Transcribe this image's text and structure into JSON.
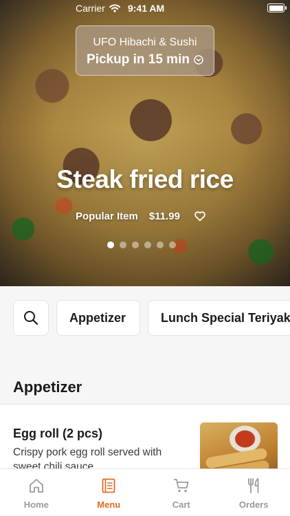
{
  "status_bar": {
    "carrier": "Carrier",
    "time": "9:41 AM"
  },
  "store": {
    "name": "UFO Hibachi & Sushi",
    "pickup": "Pickup in 15 min"
  },
  "hero": {
    "dish_name": "Steak fried rice",
    "badge": "Popular Item",
    "price": "$11.99",
    "slide_count": 6,
    "active_slide": 1
  },
  "categories": {
    "items": [
      "Appetizer",
      "Lunch Special Teriyaki"
    ]
  },
  "section": {
    "title": "Appetizer"
  },
  "menu_item": {
    "name": "Egg roll (2 pcs)",
    "description": "Crispy pork egg roll served with sweet chili sauce"
  },
  "tab_bar": {
    "tabs": [
      {
        "label": "Home",
        "icon": "home-icon"
      },
      {
        "label": "Menu",
        "icon": "menu-icon"
      },
      {
        "label": "Cart",
        "icon": "cart-icon"
      },
      {
        "label": "Orders",
        "icon": "fork-knife-icon"
      }
    ],
    "active": "Menu"
  },
  "colors": {
    "accent": "#e06a24",
    "inactive": "#9a9a9a",
    "background": "#f6f6f6"
  }
}
